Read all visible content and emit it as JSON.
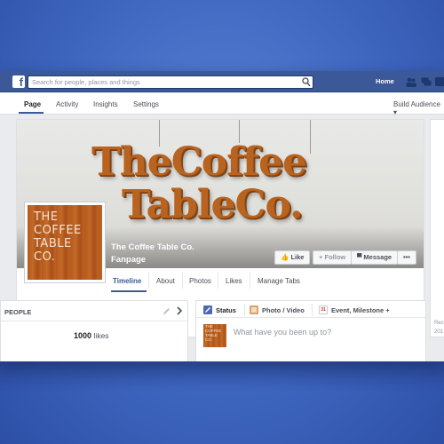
{
  "topbar": {
    "logo": "f",
    "search_placeholder": "Search for people, places and things",
    "home_label": "Home",
    "icons": [
      "search-icon",
      "friends-icon",
      "messages-icon",
      "notifications-icon"
    ]
  },
  "pagenav": {
    "items": [
      "Page",
      "Activity",
      "Insights",
      "Settings"
    ],
    "active": "Page",
    "build_audience": "Build Audience ▾"
  },
  "cover": {
    "headline_line1": "TheCoffee",
    "headline_line2": "TableCo.",
    "profile_lines": [
      "THE",
      "COFFEE",
      "TABLE",
      "CO."
    ],
    "page_name": "The Coffee Table Co.",
    "page_type": "Fanpage",
    "buttons": {
      "like": "Like",
      "follow": "Follow",
      "message": "Message",
      "more": "•••"
    },
    "tabs": [
      "Timeline",
      "About",
      "Photos",
      "Likes",
      "Manage Tabs"
    ],
    "active_tab": "Timeline"
  },
  "side": {
    "line1": "Rec",
    "line2": "201"
  },
  "people": {
    "heading": "PEOPLE",
    "likes_count": "1000",
    "likes_label": "likes"
  },
  "composer": {
    "tabs": [
      "Status",
      "Photo / Video",
      "Event, Milestone +"
    ],
    "event_icon_day": "31",
    "placeholder": "What have you been up to?",
    "avatar_lines": [
      "THE",
      "COFFEE",
      "TABLE",
      "CO."
    ]
  },
  "colors": {
    "fb_blue": "#3b5998",
    "background": "#3f67c0",
    "wood": "#b8631f"
  }
}
